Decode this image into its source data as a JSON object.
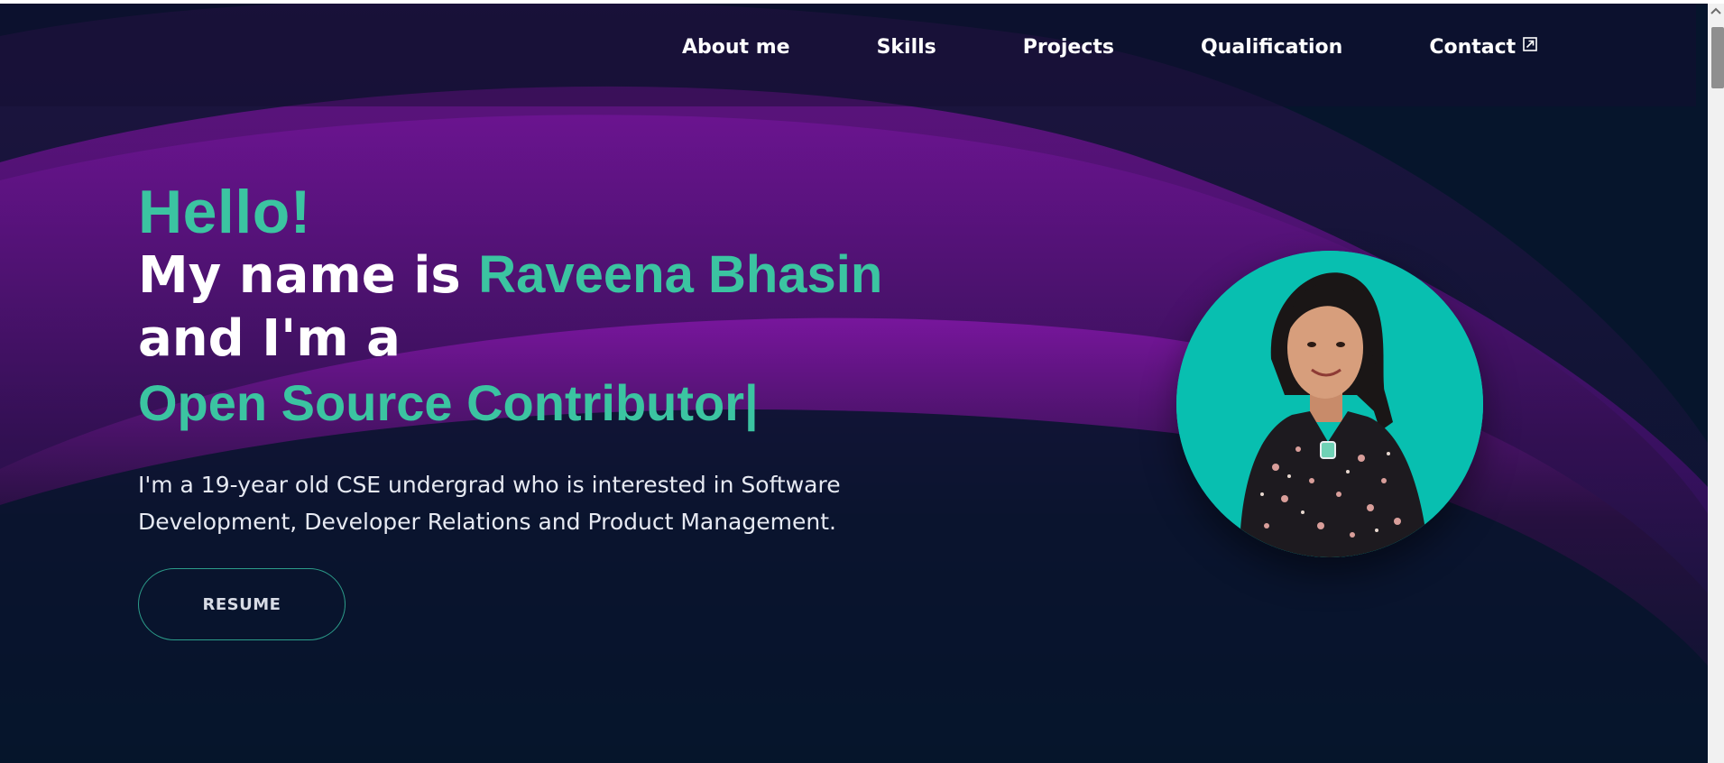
{
  "nav": {
    "items": [
      {
        "label": "About me"
      },
      {
        "label": "Skills"
      },
      {
        "label": "Projects"
      },
      {
        "label": "Qualification"
      },
      {
        "label": "Contact",
        "icon": "external-link-icon"
      }
    ]
  },
  "hero": {
    "greeting": "Hello!",
    "name_prefix": "My name is ",
    "name": "Raveena Bhasin",
    "role_prefix": "and I'm a",
    "role": "Open Source Contributor",
    "cursor": "|",
    "intro": "I'm a 19-year old CSE undergrad who is interested in Software Development, Developer Relations and Product Management.",
    "resume_label": "RESUME",
    "profile_image": "profile-photo"
  },
  "colors": {
    "background": "#06152c",
    "accent_teal": "#3bc4a1",
    "wave_purple": "#6a1290",
    "avatar_bg": "#08bfb0"
  }
}
